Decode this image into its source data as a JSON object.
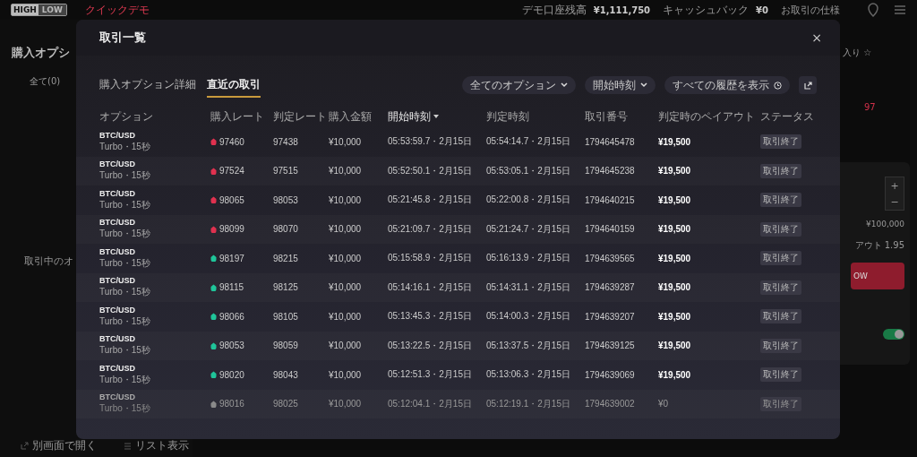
{
  "app_bar": {
    "logo_top": "HIGH",
    "logo_bottom": "LOW",
    "mode": "クイックデモ",
    "balance_label": "デモ口座残高",
    "balance": "¥1,111,750",
    "cashback_label": "キャッシュバック",
    "cashback": "¥0",
    "spec_link": "お取引の仕様"
  },
  "page": {
    "title": "購入オプシ",
    "filter": "全て(0)",
    "empty_text": "取引中のオ",
    "open_window": "別画面で開く",
    "list_view": "リスト表示",
    "favorite": "入り ☆",
    "rate": "97",
    "amount": "¥100,000",
    "payout": "アウト 1.95",
    "buy_button": "OW",
    "plus": "+",
    "minus": "−",
    "toggle_on": true
  },
  "modal": {
    "title": "取引一覧",
    "close": "×",
    "tabs": [
      {
        "label": "購入オプション詳細",
        "selected": false
      },
      {
        "label": "直近の取引",
        "selected": true
      }
    ],
    "filters": [
      "全てのオプション",
      "開始時刻"
    ],
    "history_button": "すべての履歴を表示",
    "columns": [
      {
        "label": "オプション",
        "sorted": false
      },
      {
        "label": "購入レート",
        "sorted": false
      },
      {
        "label": "判定レート",
        "sorted": false
      },
      {
        "label": "購入金額",
        "sorted": false
      },
      {
        "label": "開始時刻",
        "sorted": true
      },
      {
        "label": "判定時刻",
        "sorted": false
      },
      {
        "label": "取引番号",
        "sorted": false
      },
      {
        "label": "判定時のペイアウト",
        "sorted": false
      },
      {
        "label": "ステータス",
        "sorted": false
      }
    ],
    "rows": [
      {
        "asset": "BTC/USD",
        "type": "Turbo・15秒",
        "color": "#e0314f",
        "rate": "97460",
        "judged": "97438",
        "amount": "¥10,000",
        "start": "05:53:59.7・2月15日",
        "end": "05:54:14.7・2月15日",
        "id": "1794645478",
        "payout": "¥19,500",
        "won": true,
        "status": "取引終了"
      },
      {
        "asset": "BTC/USD",
        "type": "Turbo・15秒",
        "color": "#e0314f",
        "rate": "97524",
        "judged": "97515",
        "amount": "¥10,000",
        "start": "05:52:50.1・2月15日",
        "end": "05:53:05.1・2月15日",
        "id": "1794645238",
        "payout": "¥19,500",
        "won": true,
        "status": "取引終了"
      },
      {
        "asset": "BTC/USD",
        "type": "Turbo・15秒",
        "color": "#e0314f",
        "rate": "98065",
        "judged": "98053",
        "amount": "¥10,000",
        "start": "05:21:45.8・2月15日",
        "end": "05:22:00.8・2月15日",
        "id": "1794640215",
        "payout": "¥19,500",
        "won": true,
        "status": "取引終了"
      },
      {
        "asset": "BTC/USD",
        "type": "Turbo・15秒",
        "color": "#e0314f",
        "rate": "98099",
        "judged": "98070",
        "amount": "¥10,000",
        "start": "05:21:09.7・2月15日",
        "end": "05:21:24.7・2月15日",
        "id": "1794640159",
        "payout": "¥19,500",
        "won": true,
        "status": "取引終了"
      },
      {
        "asset": "BTC/USD",
        "type": "Turbo・15秒",
        "color": "#1fc59a",
        "rate": "98197",
        "judged": "98215",
        "amount": "¥10,000",
        "start": "05:15:58.9・2月15日",
        "end": "05:16:13.9・2月15日",
        "id": "1794639565",
        "payout": "¥19,500",
        "won": true,
        "status": "取引終了"
      },
      {
        "asset": "BTC/USD",
        "type": "Turbo・15秒",
        "color": "#1fc59a",
        "rate": "98115",
        "judged": "98125",
        "amount": "¥10,000",
        "start": "05:14:16.1・2月15日",
        "end": "05:14:31.1・2月15日",
        "id": "1794639287",
        "payout": "¥19,500",
        "won": true,
        "status": "取引終了"
      },
      {
        "asset": "BTC/USD",
        "type": "Turbo・15秒",
        "color": "#1fc59a",
        "rate": "98066",
        "judged": "98105",
        "amount": "¥10,000",
        "start": "05:13:45.3・2月15日",
        "end": "05:14:00.3・2月15日",
        "id": "1794639207",
        "payout": "¥19,500",
        "won": true,
        "status": "取引終了"
      },
      {
        "asset": "BTC/USD",
        "type": "Turbo・15秒",
        "color": "#1fc59a",
        "rate": "98053",
        "judged": "98059",
        "amount": "¥10,000",
        "start": "05:13:22.5・2月15日",
        "end": "05:13:37.5・2月15日",
        "id": "1794639125",
        "payout": "¥19,500",
        "won": true,
        "status": "取引終了"
      },
      {
        "asset": "BTC/USD",
        "type": "Turbo・15秒",
        "color": "#1fc59a",
        "rate": "98020",
        "judged": "98043",
        "amount": "¥10,000",
        "start": "05:12:51.3・2月15日",
        "end": "05:13:06.3・2月15日",
        "id": "1794639069",
        "payout": "¥19,500",
        "won": true,
        "status": "取引終了"
      },
      {
        "asset": "BTC/USD",
        "type": "Turbo・15秒",
        "color": "#8a8a8a",
        "rate": "98016",
        "judged": "98025",
        "amount": "¥10,000",
        "start": "05:12:04.1・2月15日",
        "end": "05:12:19.1・2月15日",
        "id": "1794639002",
        "payout": "¥0",
        "won": false,
        "status": "取引終了"
      }
    ]
  }
}
